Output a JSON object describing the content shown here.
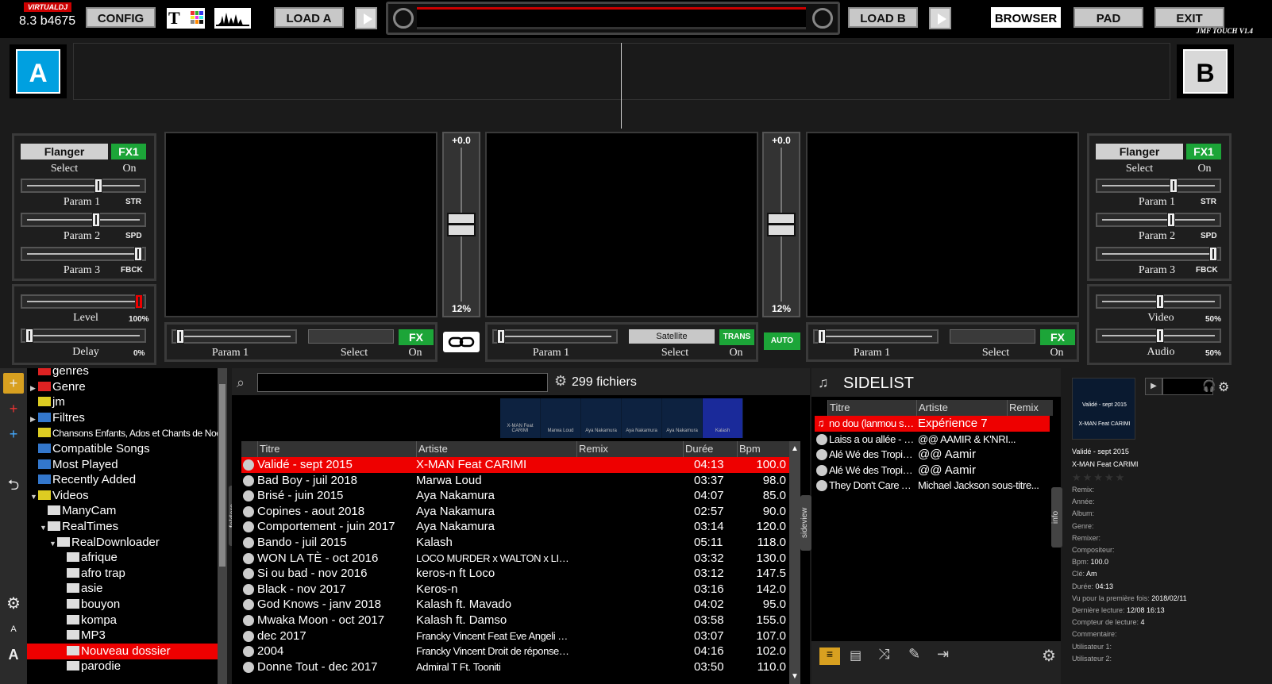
{
  "app": {
    "logo_text": "VIRTUALDJ",
    "version": "8.3 b4675"
  },
  "top": {
    "config": "CONFIG",
    "load_a": "LOAD A",
    "load_b": "LOAD B",
    "browser": "BROWSER",
    "pad": "PAD",
    "exit": "EXIT",
    "t_icon": "T",
    "skin_credit": "JMF TOUCH V1.4"
  },
  "decks": {
    "a": "A",
    "b": "B"
  },
  "fx_left": {
    "effect": "Flanger",
    "slot": "FX1",
    "select": "Select",
    "on": "On",
    "p1": "Param 1",
    "p1_tag": "STR",
    "p1_value": 0.62,
    "p2": "Param 2",
    "p2_tag": "SPD",
    "p2_value": 0.6,
    "p3": "Param 3",
    "p3_tag": "FBCK",
    "p3_value": 0.98
  },
  "fx_right": {
    "effect": "Flanger",
    "slot": "FX1",
    "select": "Select",
    "on": "On",
    "p1": "Param 1",
    "p1_tag": "STR",
    "p1_value": 0.62,
    "p2": "Param 2",
    "p2_tag": "SPD",
    "p2_value": 0.6,
    "p3": "Param 3",
    "p3_tag": "FBCK",
    "p3_value": 0.98
  },
  "level_left": {
    "level": "Level",
    "level_pct": "100%",
    "delay": "Delay",
    "delay_pct": "0%"
  },
  "level_right": {
    "video": "Video",
    "video_pct": "50%",
    "audio": "Audio",
    "audio_pct": "50%"
  },
  "pitch_left": {
    "value": "+0.0",
    "range": "12%"
  },
  "pitch_right": {
    "value": "+0.0",
    "range": "12%"
  },
  "bottom_fx": {
    "left": {
      "param": "Param 1",
      "select": "Select",
      "on": "On",
      "btn": "FX"
    },
    "center": {
      "param": "Param 1",
      "name": "Satellite",
      "select": "Select",
      "on": "On",
      "btn": "TRANS"
    },
    "right": {
      "param": "Param 1",
      "select": "Select",
      "on": "On",
      "btn": "FX"
    },
    "auto": "AUTO"
  },
  "tree": {
    "items": [
      {
        "label": "genres",
        "indent": 0,
        "color": "red",
        "arrow": ""
      },
      {
        "label": "Genre",
        "indent": 0,
        "color": "red",
        "arrow": "▶"
      },
      {
        "label": "jm",
        "indent": 0,
        "color": "yellow",
        "arrow": ""
      },
      {
        "label": "Filtres",
        "indent": 0,
        "color": "blue",
        "arrow": "▶"
      },
      {
        "label": "Chansons Enfants, Ados et Chants de Noel",
        "indent": 0,
        "color": "yellow",
        "arrow": ""
      },
      {
        "label": "Compatible Songs",
        "indent": 0,
        "color": "blue",
        "arrow": ""
      },
      {
        "label": "Most Played",
        "indent": 0,
        "color": "blue",
        "arrow": ""
      },
      {
        "label": "Recently Added",
        "indent": 0,
        "color": "blue",
        "arrow": ""
      },
      {
        "label": "Videos",
        "indent": 0,
        "color": "yellow",
        "arrow": "▼"
      },
      {
        "label": "ManyCam",
        "indent": 1,
        "color": "",
        "arrow": ""
      },
      {
        "label": "RealTimes",
        "indent": 1,
        "color": "",
        "arrow": "▼"
      },
      {
        "label": "RealDownloader",
        "indent": 2,
        "color": "",
        "arrow": "▼"
      },
      {
        "label": "afrique",
        "indent": 3,
        "color": "",
        "arrow": ""
      },
      {
        "label": "afro trap",
        "indent": 3,
        "color": "",
        "arrow": ""
      },
      {
        "label": "asie",
        "indent": 3,
        "color": "",
        "arrow": ""
      },
      {
        "label": "bouyon",
        "indent": 3,
        "color": "",
        "arrow": ""
      },
      {
        "label": "kompa",
        "indent": 3,
        "color": "",
        "arrow": ""
      },
      {
        "label": "MP3",
        "indent": 3,
        "color": "",
        "arrow": ""
      },
      {
        "label": "Nouveau dossier",
        "indent": 3,
        "color": "",
        "arrow": "",
        "selected": true
      },
      {
        "label": "parodie",
        "indent": 3,
        "color": "",
        "arrow": ""
      }
    ]
  },
  "browser": {
    "search_placeholder": "",
    "file_count": "299 fichiers",
    "tab_folders": "folders",
    "tab_sideview": "sideview",
    "columns": [
      "Titre",
      "Artiste",
      "Remix",
      "Durée",
      "Bpm"
    ],
    "rows": [
      {
        "title": "Validé - sept 2015",
        "artist": "X-MAN Feat CARIMI",
        "remix": "",
        "duration": "04:13",
        "bpm": "100.0",
        "selected": true
      },
      {
        "title": "Bad Boy - juil 2018",
        "artist": "Marwa Loud",
        "remix": "",
        "duration": "03:37",
        "bpm": "98.0"
      },
      {
        "title": "Brisé - juin 2015",
        "artist": "Aya Nakamura",
        "remix": "",
        "duration": "04:07",
        "bpm": "85.0"
      },
      {
        "title": "Copines - aout 2018",
        "artist": "Aya Nakamura",
        "remix": "",
        "duration": "02:57",
        "bpm": "90.0"
      },
      {
        "title": "Comportement - juin 2017",
        "artist": "Aya Nakamura",
        "remix": "",
        "duration": "03:14",
        "bpm": "120.0"
      },
      {
        "title": "Bando - juil 2015",
        "artist": "Kalash",
        "remix": "",
        "duration": "05:11",
        "bpm": "118.0"
      },
      {
        "title": "WON LA TÈ - oct 2016",
        "artist": "LOCO MURDER x WALTON x LIGTHA",
        "remix": "",
        "duration": "03:32",
        "bpm": "130.0",
        "cond": true
      },
      {
        "title": "Si ou bad - nov 2016",
        "artist": "keros-n ft Loco",
        "remix": "",
        "duration": "03:12",
        "bpm": "147.5"
      },
      {
        "title": "Black - nov 2017",
        "artist": "Keros-n",
        "remix": "",
        "duration": "03:16",
        "bpm": "142.0"
      },
      {
        "title": "God Knows - janv 2018",
        "artist": "Kalash ft. Mavado",
        "remix": "",
        "duration": "04:02",
        "bpm": "95.0"
      },
      {
        "title": "Mwaka Moon - oct 2017",
        "artist": "Kalash ft. Damso",
        "remix": "",
        "duration": "03:58",
        "bpm": "155.0"
      },
      {
        "title": "dec 2017",
        "artist": "Francky Vincent Feat Eve Angeli T'es c...",
        "remix": "",
        "duration": "03:07",
        "bpm": "107.0",
        "cond": true
      },
      {
        "title": "2004",
        "artist": "Francky Vincent  Droit de réponse (Res...",
        "remix": "",
        "duration": "04:16",
        "bpm": "102.0",
        "cond": true
      },
      {
        "title": "Donne Tout - dec 2017",
        "artist": "Admiral T Ft. Tooniti",
        "remix": "",
        "duration": "03:50",
        "bpm": "110.0",
        "cond": true
      }
    ],
    "cover_strip": [
      {
        "top": "",
        "bottom": "X-MAN Feat CARIMI"
      },
      {
        "top": "",
        "bottom": "Marwa Loud"
      },
      {
        "top": "",
        "bottom": "Aya Nakamura"
      },
      {
        "top": "",
        "bottom": "Aya Nakamura"
      },
      {
        "top": "",
        "bottom": "Aya Nakamura"
      },
      {
        "top": "",
        "bottom": "Kalash"
      }
    ]
  },
  "sidelist": {
    "title": "SIDELIST",
    "columns": [
      "Titre",
      "Artiste",
      "Remix"
    ],
    "rows": [
      {
        "title": "no dou (lanmou sé on c",
        "artist": "Expérience 7",
        "selected": true
      },
      {
        "title": "Laiss a ou allée - GO...",
        "artist": "@@ AAMIR & K'NRI..."
      },
      {
        "title": "Alé Wé des Tropique...",
        "artist": "@@ Aamir"
      },
      {
        "title": "Alé Wé des Tropique...",
        "artist": "@@ Aamir"
      },
      {
        "title": "They Don't Care Abo...",
        "artist": "Michael Jackson sous-titre..."
      }
    ],
    "tab_info": "info"
  },
  "info": {
    "cover_line1": "Validé - sept 2015",
    "cover_line2": "X-MAN Feat CARIMI",
    "title": "Validé - sept 2015",
    "artist": "X-MAN Feat CARIMI",
    "fields": [
      {
        "label": "Remix:",
        "value": ""
      },
      {
        "label": "Année:",
        "value": ""
      },
      {
        "label": "Album:",
        "value": ""
      },
      {
        "label": "Genre:",
        "value": ""
      },
      {
        "label": "Remixer:",
        "value": ""
      },
      {
        "label": "Compositeur:",
        "value": ""
      },
      {
        "label": "Bpm:",
        "value": "100.0"
      },
      {
        "label": "Clé:",
        "value": "Am"
      },
      {
        "label": "Durée:",
        "value": "04:13"
      },
      {
        "label": "Vu pour la première fois:",
        "value": "2018/02/11"
      },
      {
        "label": "Dernière lecture:",
        "value": "12/08 16:13"
      },
      {
        "label": "Compteur de lecture:",
        "value": "4"
      },
      {
        "label": "Commentaire:",
        "value": ""
      },
      {
        "label": "Utilisateur 1:",
        "value": ""
      },
      {
        "label": "Utilisateur 2:",
        "value": ""
      }
    ]
  },
  "colors": {
    "accent_red": "#ee0000",
    "accent_green": "#1ca538",
    "deck_a": "#00a0e0",
    "deck_b": "#d8d8d8"
  }
}
